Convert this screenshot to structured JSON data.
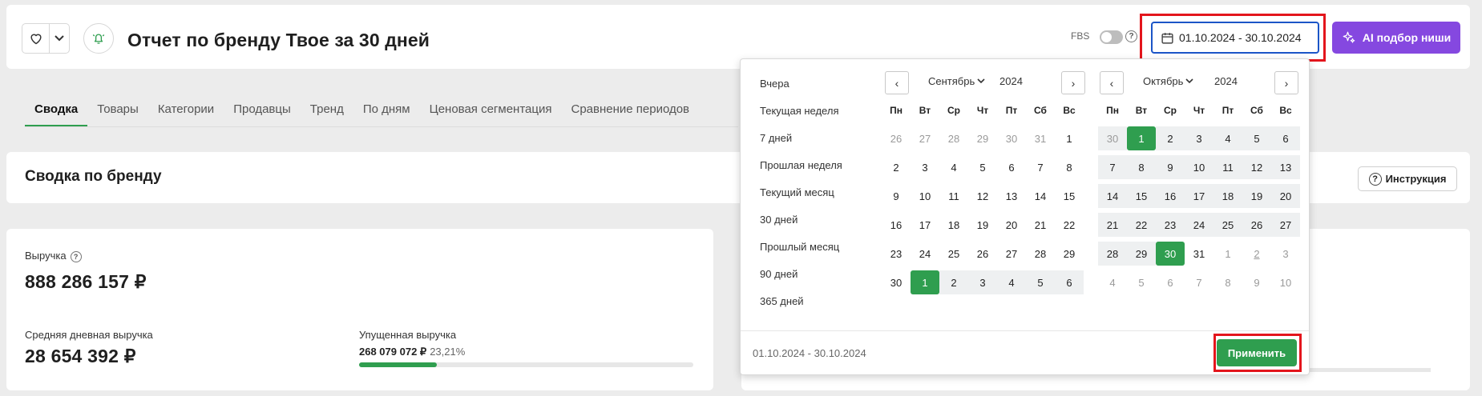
{
  "header": {
    "title": "Отчет по бренду Твое за 30 дней",
    "fbs_label": "FBS",
    "fbs_help": "?",
    "date_range": "01.10.2024 - 30.10.2024",
    "ai_button": "AI подбор ниши"
  },
  "tabs": [
    {
      "label": "Сводка",
      "active": true
    },
    {
      "label": "Товары"
    },
    {
      "label": "Категории"
    },
    {
      "label": "Продавцы"
    },
    {
      "label": "Тренд"
    },
    {
      "label": "По дням"
    },
    {
      "label": "Ценовая сегментация"
    },
    {
      "label": "Сравнение периодов"
    }
  ],
  "summary": {
    "title": "Сводка по бренду",
    "instruction_button": "Инструкция",
    "instruction_icon": "?"
  },
  "metrics": {
    "revenue_label": "Выручка",
    "revenue_help": "?",
    "revenue_value": "888 286 157 ₽",
    "avg_daily_label": "Средняя дневная выручка",
    "avg_daily_value": "28 654 392 ₽",
    "lost_label": "Упущенная выручка",
    "lost_value": "268 079 072 ₽",
    "lost_percent": "23,21%",
    "lost_progress": 0.2321
  },
  "calendar": {
    "presets": [
      "Вчера",
      "Текущая неделя",
      "7 дней",
      "Прошлая неделя",
      "Текущий месяц",
      "30 дней",
      "Прошлый месяц",
      "90 дней",
      "365 дней"
    ],
    "weekdays": [
      "Пн",
      "Вт",
      "Ср",
      "Чт",
      "Пт",
      "Сб",
      "Вс"
    ],
    "prev_icon": "‹",
    "next_icon": "›",
    "left": {
      "month": "Сентябрь",
      "year": "2024",
      "days": [
        [
          "26",
          "27",
          "28",
          "29",
          "30",
          "31",
          "1"
        ],
        [
          "2",
          "3",
          "4",
          "5",
          "6",
          "7",
          "8"
        ],
        [
          "9",
          "10",
          "11",
          "12",
          "13",
          "14",
          "15"
        ],
        [
          "16",
          "17",
          "18",
          "19",
          "20",
          "21",
          "22"
        ],
        [
          "23",
          "24",
          "25",
          "26",
          "27",
          "28",
          "29"
        ],
        [
          "30",
          "1",
          "2",
          "3",
          "4",
          "5",
          "6"
        ]
      ]
    },
    "right": {
      "month": "Октябрь",
      "year": "2024",
      "days": [
        [
          "30",
          "1",
          "2",
          "3",
          "4",
          "5",
          "6"
        ],
        [
          "7",
          "8",
          "9",
          "10",
          "11",
          "12",
          "13"
        ],
        [
          "14",
          "15",
          "16",
          "17",
          "18",
          "19",
          "20"
        ],
        [
          "21",
          "22",
          "23",
          "24",
          "25",
          "26",
          "27"
        ],
        [
          "28",
          "29",
          "30",
          "31",
          "1",
          "2",
          "3"
        ],
        [
          "4",
          "5",
          "6",
          "7",
          "8",
          "9",
          "10"
        ]
      ]
    },
    "range_text": "01.10.2024 - 30.10.2024",
    "apply_button": "Применить"
  }
}
